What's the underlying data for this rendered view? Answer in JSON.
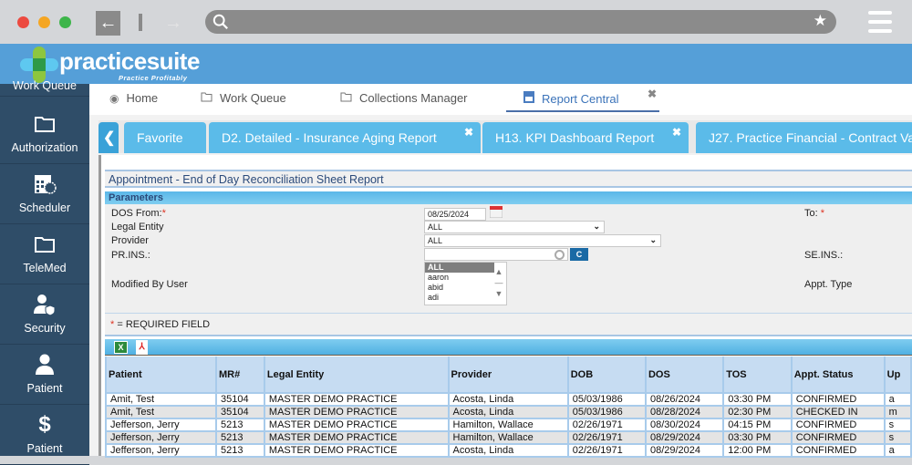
{
  "browser": {
    "search_icon": "search-icon",
    "bookmark_icon": "star-icon",
    "menu_icon": "hamburger-icon"
  },
  "app": {
    "logo_text": "practicesuite",
    "logo_tagline": "Practice Profitably ™",
    "brand_color": "#559fd8"
  },
  "sidebar": {
    "items": [
      {
        "label": "Work Queue",
        "icon": "folder-icon"
      },
      {
        "label": "Authorization",
        "icon": "folder-icon"
      },
      {
        "label": "Scheduler",
        "icon": "calendar-clock-icon"
      },
      {
        "label": "TeleMed",
        "icon": "folder-icon"
      },
      {
        "label": "Security",
        "icon": "user-shield-icon"
      },
      {
        "label": "Patient",
        "icon": "user-icon"
      },
      {
        "label": "Patient",
        "icon": "dollar-icon"
      }
    ]
  },
  "topnav": {
    "items": [
      {
        "label": "Home",
        "icon": "dashboard-icon"
      },
      {
        "label": "Work Queue",
        "icon": "folder-icon"
      },
      {
        "label": "Collections Manager",
        "icon": "folder-icon"
      },
      {
        "label": "Report Central",
        "icon": "report-icon",
        "active": true
      }
    ],
    "close_label": "✖"
  },
  "report_tabs": {
    "back_label": "❮",
    "tabs": [
      {
        "label": "Favorite"
      },
      {
        "label": "D2. Detailed - Insurance Aging Report",
        "close": "✖"
      },
      {
        "label": "H13. KPI Dashboard Report",
        "close": "✖"
      },
      {
        "label": "J27. Practice Financial - Contract Va"
      }
    ]
  },
  "report": {
    "title": "Appointment - End of Day Reconciliation Sheet Report",
    "parameters_header": "Parameters",
    "fields": {
      "dos_from_label": "DOS From:",
      "dos_from_value": "08/25/2024",
      "to_label": "To:",
      "legal_entity_label": "Legal Entity",
      "legal_entity_value": "ALL",
      "provider_label": "Provider",
      "provider_value": "ALL",
      "pr_ins_label": "PR.INS.:",
      "pr_ins_value": "",
      "se_ins_label": "SE.INS.:",
      "modified_by_label": "Modified By User",
      "modified_by_options": [
        "ALL",
        "aaron",
        "abid",
        "adi"
      ],
      "modified_by_selected": "ALL",
      "appt_type_label": "Appt. Type",
      "clear_button": "C"
    },
    "required_star": "*",
    "required_note": "= REQUIRED FIELD",
    "export": {
      "excel": "X",
      "pdf": "⅄"
    }
  },
  "table": {
    "columns": [
      "Patient",
      "MR#",
      "Legal Entity",
      "Provider",
      "DOB",
      "DOS",
      "TOS",
      "Appt. Status",
      "Up"
    ],
    "rows": [
      [
        "Amit, Test",
        "35104",
        "MASTER DEMO PRACTICE",
        "Acosta, Linda",
        "05/03/1986",
        "08/26/2024",
        "03:30 PM",
        "CONFIRMED",
        "a"
      ],
      [
        "Amit, Test",
        "35104",
        "MASTER DEMO PRACTICE",
        "Acosta, Linda",
        "05/03/1986",
        "08/28/2024",
        "02:30 PM",
        "CHECKED IN",
        "m"
      ],
      [
        "Jefferson, Jerry",
        "5213",
        "MASTER DEMO PRACTICE",
        "Hamilton, Wallace",
        "02/26/1971",
        "08/30/2024",
        "04:15 PM",
        "CONFIRMED",
        "s"
      ],
      [
        "Jefferson, Jerry",
        "5213",
        "MASTER DEMO PRACTICE",
        "Hamilton, Wallace",
        "02/26/1971",
        "08/29/2024",
        "03:30 PM",
        "CONFIRMED",
        "s"
      ],
      [
        "Jefferson, Jerry",
        "5213",
        "MASTER DEMO PRACTICE",
        "Acosta, Linda",
        "02/26/1971",
        "08/29/2024",
        "12:00 PM",
        "CONFIRMED",
        "a"
      ]
    ]
  }
}
